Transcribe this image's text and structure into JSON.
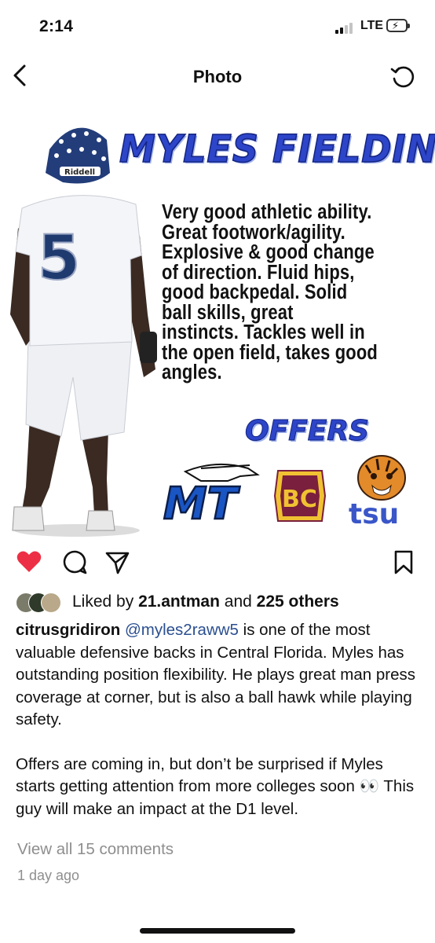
{
  "status_bar": {
    "time": "2:14",
    "network": "LTE"
  },
  "nav": {
    "title": "Photo",
    "back_icon": "chevron-left-icon",
    "refresh_icon": "refresh-icon"
  },
  "photo": {
    "headline": "MYLES FIELDINGS",
    "helmet_brand": "Riddell",
    "jersey_number": "5",
    "scouting_report": "Very good athletic ability.\nGreat footwork/agility.\nExplosive & good change\nof direction. Fluid hips,\ngood backpedal. Solid\nball skills, great\ninstincts. Tackles well in\nthe open field, takes good\nangles.",
    "offers_title": "OFFERS",
    "offer_logos": [
      {
        "name": "MT",
        "color": "#1a55c4"
      },
      {
        "name": "BC",
        "color": "#7a1f3d"
      },
      {
        "name": "tsu",
        "color": "#3a56c8"
      }
    ]
  },
  "actions": {
    "like_icon": "heart-filled-icon",
    "comment_icon": "comment-icon",
    "share_icon": "send-icon",
    "save_icon": "bookmark-icon",
    "like_color": "#ed2f45"
  },
  "likes": {
    "prefix": "Liked by ",
    "user": "21.antman",
    "middle": " and ",
    "others": "225 others"
  },
  "caption": {
    "username": "citrusgridiron",
    "mention": "@myles2raww5",
    "paragraph1": " is one of the most valuable defensive backs in Central Florida. Myles has outstanding position flexibility. He plays great man press coverage at corner, but is also a ball hawk while playing safety.",
    "paragraph2": "Offers are coming in, but don’t be surprised if Myles starts getting attention from more colleges soon 👀 This guy will make an impact at the D1 level."
  },
  "view_comments": "View all 15 comments",
  "time_ago": "1 day ago"
}
